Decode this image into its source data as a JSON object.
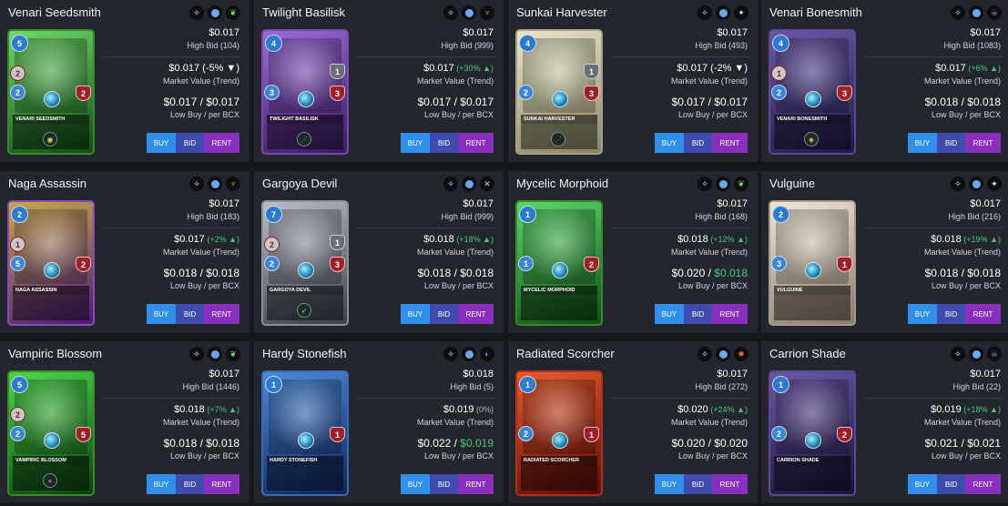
{
  "labels": {
    "high_bid": "High Bid",
    "market_value": "Market Value (Trend)",
    "low_buy": "Low Buy / per BCX",
    "buy": "BUY",
    "bid": "BID",
    "rent": "RENT"
  },
  "cards": [
    {
      "name": "Venari Seedsmith",
      "card_label": "Venari Seedsmith",
      "price": "$0.017",
      "high_bid": "104",
      "market_value": "$0.017",
      "trend": "-5%",
      "trend_dir": "down",
      "low_buy": "$0.017",
      "per_bcx": "$0.017",
      "per_green": false,
      "mana": "5",
      "attack": "2",
      "attack_type": "magic",
      "speed": "2",
      "health": "2",
      "armor": "",
      "element_icon": "leaf-icon",
      "ability_icon": "eye-icon",
      "color_from": "#6fd86a",
      "color_to": "#0f4d14",
      "border": "#3a8a2c"
    },
    {
      "name": "Twilight Basilisk",
      "card_label": "Twilight Basilisk",
      "price": "$0.017",
      "high_bid": "999",
      "market_value": "$0.017",
      "trend": "+30%",
      "trend_dir": "up",
      "low_buy": "$0.017",
      "per_bcx": "$0.017",
      "per_green": false,
      "mana": "4",
      "attack": "",
      "attack_type": "",
      "speed": "3",
      "health": "3",
      "armor": "1",
      "element_icon": "dragon-icon",
      "ability_icon": "claw-icon",
      "color_from": "#9a6ad8",
      "color_to": "#3b1a63",
      "border": "#7a4aa8"
    },
    {
      "name": "Sunkai Harvester",
      "card_label": "Sunkai Harvester",
      "price": "$0.017",
      "high_bid": "493",
      "market_value": "$0.017",
      "trend": "-2%",
      "trend_dir": "down",
      "low_buy": "$0.017",
      "per_bcx": "$0.017",
      "per_green": false,
      "mana": "4",
      "attack": "",
      "attack_type": "",
      "speed": "2",
      "health": "3",
      "armor": "1",
      "element_icon": "neutral-icon",
      "ability_icon": "claw-icon",
      "color_from": "#e9e6c9",
      "color_to": "#8a8463",
      "border": "#a8a18a"
    },
    {
      "name": "Venari Bonesmith",
      "card_label": "Venari Bonesmith",
      "price": "$0.017",
      "high_bid": "1083",
      "market_value": "$0.017",
      "trend": "+6%",
      "trend_dir": "up",
      "low_buy": "$0.018",
      "per_bcx": "$0.018",
      "per_green": false,
      "mana": "4",
      "attack": "1",
      "attack_type": "melee",
      "speed": "2",
      "health": "3",
      "armor": "",
      "element_icon": "death-icon",
      "ability_icon": "shield-icon",
      "color_from": "#6a58a8",
      "color_to": "#231a46",
      "border": "#5a4a96"
    },
    {
      "name": "Naga Assassin",
      "card_label": "Naga Assassin",
      "price": "$0.017",
      "high_bid": "183",
      "market_value": "$0.017",
      "trend": "+2%",
      "trend_dir": "up",
      "low_buy": "$0.018",
      "per_bcx": "$0.018",
      "per_green": false,
      "mana": "2",
      "attack": "1",
      "attack_type": "magic",
      "speed": "5",
      "health": "2",
      "armor": "",
      "element_icon": "dragon-icon",
      "ability_icon": "",
      "color_from": "#c9a64a",
      "color_to": "#4a1a7a",
      "border": "#8a4ab8"
    },
    {
      "name": "Gargoya Devil",
      "card_label": "Gargoya Devil",
      "price": "$0.017",
      "high_bid": "999",
      "market_value": "$0.018",
      "trend": "+18%",
      "trend_dir": "up",
      "low_buy": "$0.018",
      "per_bcx": "$0.018",
      "per_green": false,
      "mana": "7",
      "attack": "2",
      "attack_type": "magic",
      "speed": "2",
      "health": "3",
      "armor": "1",
      "element_icon": "x-icon",
      "ability_icon": "bird-icon",
      "color_from": "#b8bcc8",
      "color_to": "#3a3f4a",
      "border": "#8a8f9a"
    },
    {
      "name": "Mycelic Morphoid",
      "card_label": "Mycelic Morphoid",
      "price": "$0.017",
      "high_bid": "168",
      "market_value": "$0.018",
      "trend": "+12%",
      "trend_dir": "up",
      "low_buy": "$0.020",
      "per_bcx": "$0.018",
      "per_green": true,
      "mana": "1",
      "attack": "",
      "attack_type": "",
      "speed": "1",
      "health": "2",
      "armor": "",
      "element_icon": "leaf-icon",
      "ability_icon": "",
      "color_from": "#5ad86a",
      "color_to": "#0f4d14",
      "border": "#3a8a2c"
    },
    {
      "name": "Vulguine",
      "card_label": "Vulguine",
      "price": "$0.017",
      "high_bid": "216",
      "market_value": "$0.018",
      "trend": "+19%",
      "trend_dir": "up",
      "low_buy": "$0.018",
      "per_bcx": "$0.018",
      "per_green": false,
      "mana": "2",
      "attack": "",
      "attack_type": "",
      "speed": "3",
      "health": "1",
      "armor": "",
      "element_icon": "neutral-icon",
      "ability_icon": "",
      "color_from": "#f0e6d8",
      "color_to": "#8a7a6a",
      "border": "#a89a8a"
    },
    {
      "name": "Vampiric Blossom",
      "card_label": "Vampiric Blossom",
      "price": "$0.017",
      "high_bid": "1446",
      "market_value": "$0.018",
      "trend": "+7%",
      "trend_dir": "up",
      "low_buy": "$0.018",
      "per_bcx": "$0.018",
      "per_green": false,
      "mana": "5",
      "attack": "2",
      "attack_type": "magic",
      "speed": "2",
      "health": "5",
      "armor": "",
      "element_icon": "leaf-icon",
      "ability_icon": "lips-icon",
      "color_from": "#4ad84a",
      "color_to": "#0c3f10",
      "border": "#3a8a2c"
    },
    {
      "name": "Hardy Stonefish",
      "card_label": "Hardy Stonefish",
      "price": "$0.018",
      "high_bid": "5",
      "market_value": "$0.019",
      "trend": "0%",
      "trend_dir": "flat",
      "low_buy": "$0.022",
      "per_bcx": "$0.019",
      "per_green": true,
      "mana": "1",
      "attack": "",
      "attack_type": "",
      "speed": "",
      "health": "1",
      "armor": "",
      "element_icon": "water-icon",
      "ability_icon": "",
      "color_from": "#4a8ad8",
      "color_to": "#10245a",
      "border": "#3a6ab0"
    },
    {
      "name": "Radiated Scorcher",
      "card_label": "Radiated Scorcher",
      "price": "$0.017",
      "high_bid": "272",
      "market_value": "$0.020",
      "trend": "+24%",
      "trend_dir": "up",
      "low_buy": "$0.020",
      "per_bcx": "$0.020",
      "per_green": false,
      "mana": "1",
      "attack": "",
      "attack_type": "",
      "speed": "2",
      "health": "1",
      "armor": "",
      "element_icon": "fire-icon",
      "ability_icon": "",
      "color_from": "#e85a2a",
      "color_to": "#5a0a0a",
      "border": "#b03020"
    },
    {
      "name": "Carrion Shade",
      "card_label": "Carrion Shade",
      "price": "$0.017",
      "high_bid": "22",
      "market_value": "$0.019",
      "trend": "+18%",
      "trend_dir": "up",
      "low_buy": "$0.021",
      "per_bcx": "$0.021",
      "per_green": false,
      "mana": "1",
      "attack": "",
      "attack_type": "",
      "speed": "2",
      "health": "2",
      "armor": "",
      "element_icon": "death-icon",
      "ability_icon": "",
      "color_from": "#6a58a8",
      "color_to": "#1a1236",
      "border": "#5a4a96"
    }
  ]
}
